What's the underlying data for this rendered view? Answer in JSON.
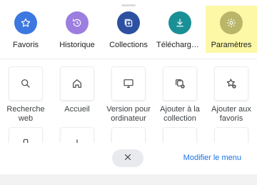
{
  "top_actions": [
    {
      "label": "Favoris",
      "icon": "star-icon",
      "color": "#3c78e0"
    },
    {
      "label": "Historique",
      "icon": "history-icon",
      "color": "#9b7ee0"
    },
    {
      "label": "Collections",
      "icon": "collections-icon",
      "color": "#2d50a0"
    },
    {
      "label": "Télécharge…",
      "icon": "download-icon",
      "color": "#1b8f96"
    },
    {
      "label": "Paramètres",
      "icon": "gear-icon",
      "color": "#b9b66a"
    }
  ],
  "grid_items": [
    {
      "label": "Recherche web",
      "icon": "search-icon"
    },
    {
      "label": "Accueil",
      "icon": "home-icon"
    },
    {
      "label": "Version pour ordinateur",
      "icon": "desktop-icon"
    },
    {
      "label": "Ajouter à la collection",
      "icon": "add-collection-icon"
    },
    {
      "label": "Ajouter aux favoris",
      "icon": "add-favorite-icon"
    }
  ],
  "bottom": {
    "close_icon": "close-icon",
    "modify_label": "Modifier le menu"
  },
  "colors": {
    "highlight": "#fcf8a6",
    "link": "#1a73e8"
  }
}
